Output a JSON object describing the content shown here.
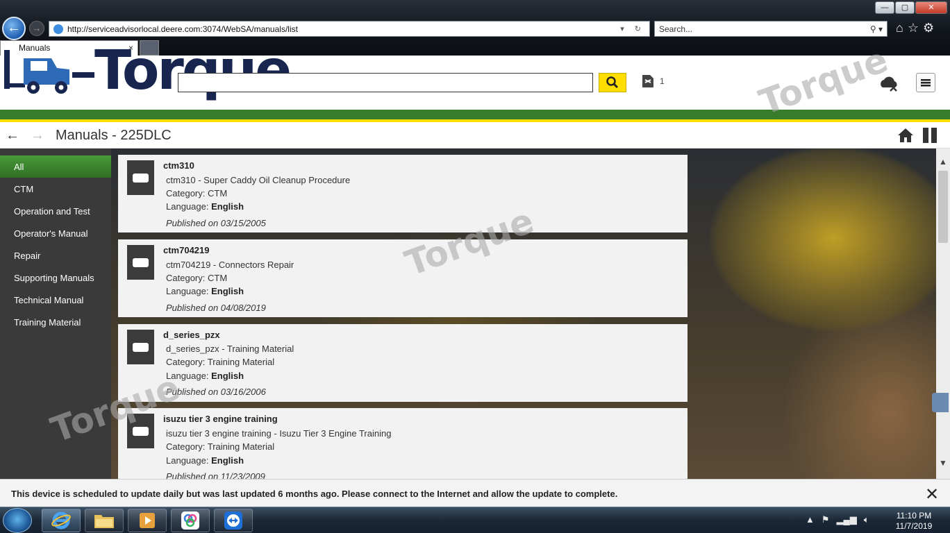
{
  "browser": {
    "window_controls": [
      "—",
      "▢",
      "✕"
    ],
    "address_url": "http://serviceadvisorlocal.deere.com:3074/WebSA/manuals/list",
    "search_placeholder": "Search...",
    "tab_label": "Manuals",
    "tab_close": "×"
  },
  "app": {
    "logo_text": "Torque",
    "search_value": "",
    "cart_count": "1",
    "colors": {
      "green": "#367c2b",
      "yellow": "#ffde00",
      "sidebar": "#3a3a3a"
    }
  },
  "breadcrumb": {
    "back_icon": "←",
    "forward_icon": "→",
    "title": "Manuals - 225DLC"
  },
  "sidebar": {
    "items": [
      {
        "label": "All",
        "active": true
      },
      {
        "label": "CTM"
      },
      {
        "label": "Operation and Test"
      },
      {
        "label": "Operator's Manual"
      },
      {
        "label": "Repair"
      },
      {
        "label": "Supporting Manuals"
      },
      {
        "label": "Technical Manual"
      },
      {
        "label": "Training Material"
      }
    ]
  },
  "manuals": [
    {
      "id": "ctm310",
      "description": "ctm310 - Super Caddy Oil Cleanup Procedure",
      "category_label": "Category:",
      "category": "CTM",
      "language_label": "Language:",
      "language": "English",
      "published": "Published on 03/15/2005"
    },
    {
      "id": "ctm704219",
      "description": "ctm704219 - Connectors Repair",
      "category_label": "Category:",
      "category": "CTM",
      "language_label": "Language:",
      "language": "English",
      "published": "Published on 04/08/2019"
    },
    {
      "id": "d_series_pzx",
      "description": "d_series_pzx - Training Material",
      "category_label": "Category:",
      "category": "Training Material",
      "language_label": "Language:",
      "language": "English",
      "published": "Published on 03/16/2006"
    },
    {
      "id": "isuzu tier 3 engine training",
      "description": "isuzu tier 3 engine training - Isuzu Tier 3 Engine Training",
      "category_label": "Category:",
      "category": "Training Material",
      "language_label": "Language:",
      "language": "English",
      "published": "Published on 11/23/2009"
    }
  ],
  "notice": {
    "text": "This device is scheduled to update daily but was last updated 6 months ago. Please connect to the Internet and allow the update to complete.",
    "close": "✕"
  },
  "taskbar": {
    "time": "11:10 PM",
    "date": "11/7/2019",
    "tray_icons": [
      "▲",
      "flag-icon",
      "network-icon",
      "volume-icon"
    ]
  }
}
